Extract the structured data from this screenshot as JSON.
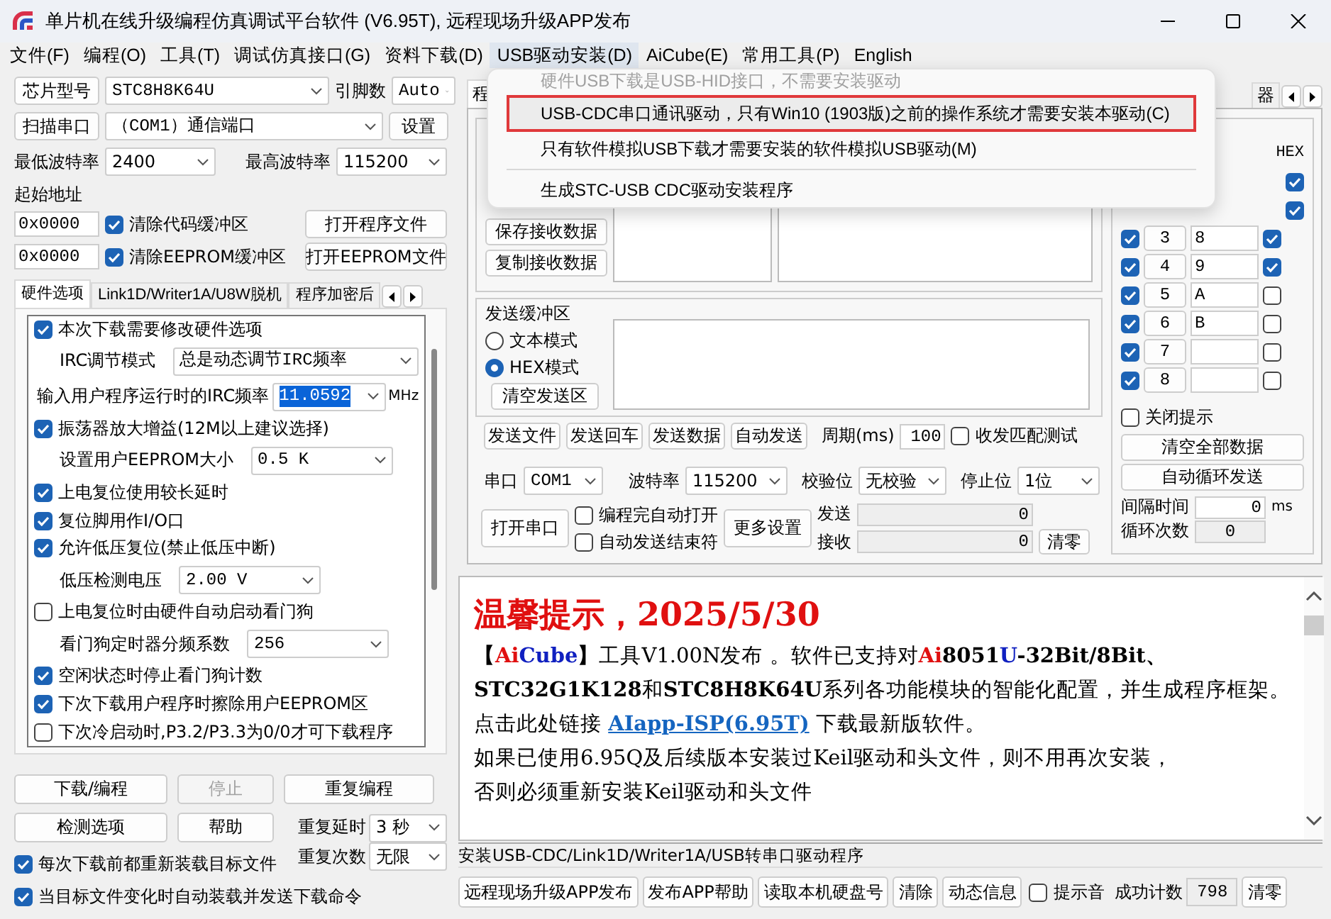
{
  "window": {
    "title": "单片机在线升级编程仿真调试平台软件 (V6.95T), 远程现场升级APP发布"
  },
  "menu_bar": [
    {
      "label": "文件(F)",
      "selected": false
    },
    {
      "label": "编程(O)",
      "selected": false
    },
    {
      "label": "工具(T)",
      "selected": false
    },
    {
      "label": "调试仿真接口(G)",
      "selected": false
    },
    {
      "label": "资料下载(D)",
      "selected": false
    },
    {
      "label": "USB驱动安装(D)",
      "selected": true
    },
    {
      "label": "AiCube(E)",
      "selected": false
    },
    {
      "label": "常用工具(P)",
      "selected": false
    },
    {
      "label": "English",
      "selected": false
    }
  ],
  "dropdown_menu": {
    "items": [
      {
        "kind": "item",
        "label": "硬件USB下载是USB-HID接口，不需要安装驱动",
        "disabled": true,
        "highlighted": false
      },
      {
        "kind": "item",
        "label": "USB-CDC串口通讯驱动，只有Win10 (1903版)之前的操作系统才需要安装本驱动(C)",
        "disabled": false,
        "highlighted": true
      },
      {
        "kind": "item",
        "label": "只有软件模拟USB下载才需要安装的软件模拟USB驱动(M)",
        "disabled": false,
        "highlighted": false
      },
      {
        "kind": "separator"
      },
      {
        "kind": "item",
        "label": "生成STC-USB CDC驱动安装程序",
        "disabled": false,
        "highlighted": false
      }
    ]
  },
  "left_panel": {
    "chip": {
      "button": "芯片型号",
      "value": "STC8H8K64U",
      "pins_label": "引脚数",
      "pins_value": "Auto"
    },
    "port": {
      "button": "扫描串口",
      "value": "（COM1）通信端口",
      "settings_button": "设置"
    },
    "baud": {
      "min_label": "最低波特率",
      "min_value": "2400",
      "max_label": "最高波特率",
      "max_value": "115200"
    },
    "start_address": {
      "label": "起始地址",
      "rows": [
        {
          "address": "0x0000",
          "checkbox": "清除代码缓冲区",
          "checked": true,
          "button": "打开程序文件"
        },
        {
          "address": "0x0000",
          "checkbox": "清除EEPROM缓冲区",
          "checked": true,
          "button": "打开EEPROM文件"
        }
      ]
    },
    "tabs": [
      {
        "label": "硬件选项",
        "selected": true
      },
      {
        "label": "Link1D/Writer1A/U8W脱机",
        "selected": false
      },
      {
        "label": "程序加密后",
        "selected": false
      }
    ],
    "options": [
      {
        "kind": "check",
        "label": "本次下载需要修改硬件选项",
        "checked": true
      },
      {
        "kind": "select",
        "label": "IRC调节模式",
        "value": "总是动态调节IRC频率"
      },
      {
        "kind": "input",
        "label": "输入用户程序运行时的IRC频率",
        "value": "11.0592",
        "unit": "MHz",
        "value_selected": true
      },
      {
        "kind": "check",
        "label": "振荡器放大增益(12M以上建议选择)",
        "checked": true
      },
      {
        "kind": "select",
        "label": "设置用户EEPROM大小",
        "value": "0.5 K"
      },
      {
        "kind": "check",
        "label": "上电复位使用较长延时",
        "checked": true
      },
      {
        "kind": "check",
        "label": "复位脚用作I/O口",
        "checked": true
      },
      {
        "kind": "check",
        "label": "允许低压复位(禁止低压中断)",
        "checked": true
      },
      {
        "kind": "select",
        "label": "低压检测电压",
        "value": "2.00 V"
      },
      {
        "kind": "check",
        "label": "上电复位时由硬件自动启动看门狗",
        "checked": false
      },
      {
        "kind": "select",
        "label": "看门狗定时器分频系数",
        "value": "256"
      },
      {
        "kind": "check",
        "label": "空闲状态时停止看门狗计数",
        "checked": true
      },
      {
        "kind": "check",
        "label": "下次下载用户程序时擦除用户EEPROM区",
        "checked": true
      },
      {
        "kind": "check",
        "label": "下次冷启动时,P3.2/P3.3为0/0才可下载程序",
        "checked": false
      }
    ],
    "actions": [
      {
        "label": "下载/编程",
        "disabled": false
      },
      {
        "label": "停止",
        "disabled": true
      },
      {
        "label": "重复编程",
        "disabled": false
      },
      {
        "label": "检测选项",
        "disabled": false
      },
      {
        "label": "帮助",
        "disabled": false
      }
    ],
    "repeat_delay": {
      "label": "重复延时",
      "value": "3 秒"
    },
    "repeat_count": {
      "label": "重复次数",
      "value": "无限"
    },
    "auto_checks": [
      {
        "label": "每次下载前都重新装载目标文件",
        "checked": true
      },
      {
        "label": "当目标文件变化时自动装载并发送下载命令",
        "checked": true
      }
    ]
  },
  "right_panel": {
    "tabs": [
      {
        "label": "程",
        "selected": true
      },
      {
        "label": "器",
        "selected": false
      }
    ],
    "receive": {
      "buttons": [
        "保存接收数据",
        "复制接收数据"
      ]
    },
    "send_buffer": {
      "title": "发送缓冲区",
      "modes": [
        {
          "label": "文本模式",
          "selected": false
        },
        {
          "label": "HEX模式",
          "selected": true
        }
      ],
      "clear_button": "清空发送区"
    },
    "send_actions": {
      "buttons": [
        "发送文件",
        "发送回车",
        "发送数据",
        "自动发送"
      ],
      "period_label": "周期(ms)",
      "period_value": "100",
      "match_test": {
        "label": "收发匹配测试",
        "checked": false
      }
    },
    "serial": {
      "port_label": "串口",
      "port": "COM1",
      "baud_label": "波特率",
      "baud": "115200",
      "parity_label": "校验位",
      "parity": "无校验",
      "stop_label": "停止位",
      "stop": "1位",
      "open_button": "打开串口",
      "checks": [
        {
          "label": "编程完自动打开",
          "checked": false
        },
        {
          "label": "自动发送结束符",
          "checked": false
        }
      ],
      "more_button": "更多设置",
      "sent_label": "发送",
      "sent": "0",
      "received_label": "接收",
      "received": "0",
      "clear_button": "清零"
    },
    "multi_send": {
      "header": "HEX",
      "rows": [
        {
          "kind": "partial",
          "hex": true
        },
        {
          "kind": "partial",
          "hex": true
        },
        {
          "kind": "full",
          "enabled": true,
          "number": "3",
          "text": "8",
          "hex": true
        },
        {
          "kind": "full",
          "enabled": true,
          "number": "4",
          "text": "9",
          "hex": true
        },
        {
          "kind": "full",
          "enabled": true,
          "number": "5",
          "text": "A",
          "hex": false
        },
        {
          "kind": "full",
          "enabled": true,
          "number": "6",
          "text": "B",
          "hex": false
        },
        {
          "kind": "full",
          "enabled": true,
          "number": "7",
          "text": "",
          "hex": false
        },
        {
          "kind": "full",
          "enabled": true,
          "number": "8",
          "text": "",
          "hex": false
        }
      ],
      "close_tips": {
        "label": "关闭提示",
        "checked": false
      },
      "clear_all": "清空全部数据",
      "auto_loop": "自动循环发送",
      "interval": {
        "label": "间隔时间",
        "value": "0",
        "unit": "ms"
      },
      "loop_count": {
        "label": "循环次数",
        "value": "0"
      }
    }
  },
  "message": {
    "title": "温馨提示，2025/5/30",
    "lines": [
      [
        {
          "kind": "bold",
          "text": "【"
        },
        {
          "kind": "red",
          "text": "Ai"
        },
        {
          "kind": "blue",
          "text": "Cube"
        },
        {
          "kind": "bold",
          "text": "】"
        },
        {
          "kind": "plain",
          "text": "工具V1.00N发布 。软件已支持对"
        },
        {
          "kind": "red",
          "text": "Ai"
        },
        {
          "kind": "bold",
          "text": "8051"
        },
        {
          "kind": "blue",
          "text": "U"
        },
        {
          "kind": "bold",
          "text": "-32Bit/8Bit、"
        }
      ],
      [
        {
          "kind": "bold",
          "text": "STC32G1K128"
        },
        {
          "kind": "plain",
          "text": "和"
        },
        {
          "kind": "bold",
          "text": "STC8H8K64U"
        },
        {
          "kind": "plain",
          "text": "系列各功能模块的智能化配置，并生成程序框架。"
        }
      ],
      [
        {
          "kind": "plain",
          "text": "点击此处链接 "
        },
        {
          "kind": "link",
          "text": "AIapp-ISP(6.95T)"
        },
        {
          "kind": "plain",
          "text": " 下载最新版软件。"
        }
      ],
      [
        {
          "kind": "plain",
          "text": "如果已使用6.95Q及后续版本安装过Keil驱动和头文件，则不用再次安装，"
        }
      ],
      [
        {
          "kind": "plain",
          "text": "否则必须重新安装Keil驱动和头文件"
        }
      ]
    ]
  },
  "status_text": "安装USB-CDC/Link1D/Writer1A/USB转串口驱动程序",
  "bottom_bar": {
    "buttons": [
      "远程现场升级APP发布",
      "发布APP帮助",
      "读取本机硬盘号",
      "清除",
      "动态信息"
    ],
    "beep": {
      "label": "提示音",
      "checked": false
    },
    "success_label": "成功计数",
    "success_count": "798",
    "clear_button": "清零"
  }
}
